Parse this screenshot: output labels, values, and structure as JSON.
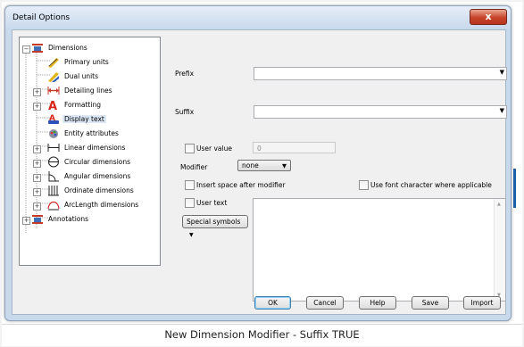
{
  "window": {
    "title": "Detail Options",
    "close_glyph": "x"
  },
  "tree": {
    "items": [
      {
        "label": "Dimensions",
        "icon": "dimensions-icon",
        "expander": "−"
      },
      {
        "label": "Primary units",
        "icon": "ruler-pencil-icon"
      },
      {
        "label": "Dual units",
        "icon": "ruler-pencil-icon"
      },
      {
        "label": "Detailing lines",
        "icon": "arrow-line-icon",
        "expander": "+"
      },
      {
        "label": "Formatting",
        "icon": "letter-a-icon",
        "expander": "+"
      },
      {
        "label": "Display text",
        "icon": "display-text-icon"
      },
      {
        "label": "Entity attributes",
        "icon": "entity-attributes-icon"
      },
      {
        "label": "Linear dimensions",
        "icon": "linear-dimension-icon",
        "expander": "+"
      },
      {
        "label": "Circular dimensions",
        "icon": "circular-dimension-icon",
        "expander": "+"
      },
      {
        "label": "Angular dimensions",
        "icon": "angular-dimension-icon",
        "expander": "+"
      },
      {
        "label": "Ordinate dimensions",
        "icon": "ordinate-dimension-icon",
        "expander": "+"
      },
      {
        "label": "ArcLength dimensions",
        "icon": "arclength-dimension-icon",
        "expander": "+"
      },
      {
        "label": "Annotations",
        "icon": "annotations-icon",
        "expander": "+"
      }
    ]
  },
  "form": {
    "prefix_label": "Prefix",
    "suffix_label": "Suffix",
    "user_value_label": "User value",
    "user_value": "0",
    "modifier_label": "Modifier",
    "modifier_value": "none",
    "insert_space_label": "Insert space after modifier",
    "use_font_char_label": "Use font character where applicable",
    "user_text_label": "User text",
    "special_symbols_label": "Special symbols"
  },
  "buttons": {
    "ok": "OK",
    "cancel": "Cancel",
    "help": "Help",
    "save": "Save",
    "import": "Import"
  },
  "caption": "New Dimension Modifier - Suffix TRUE",
  "colors": {
    "selection": "#dde8f6",
    "title_gradient_top": "#e6eef8",
    "close_red": "#c7432a"
  }
}
